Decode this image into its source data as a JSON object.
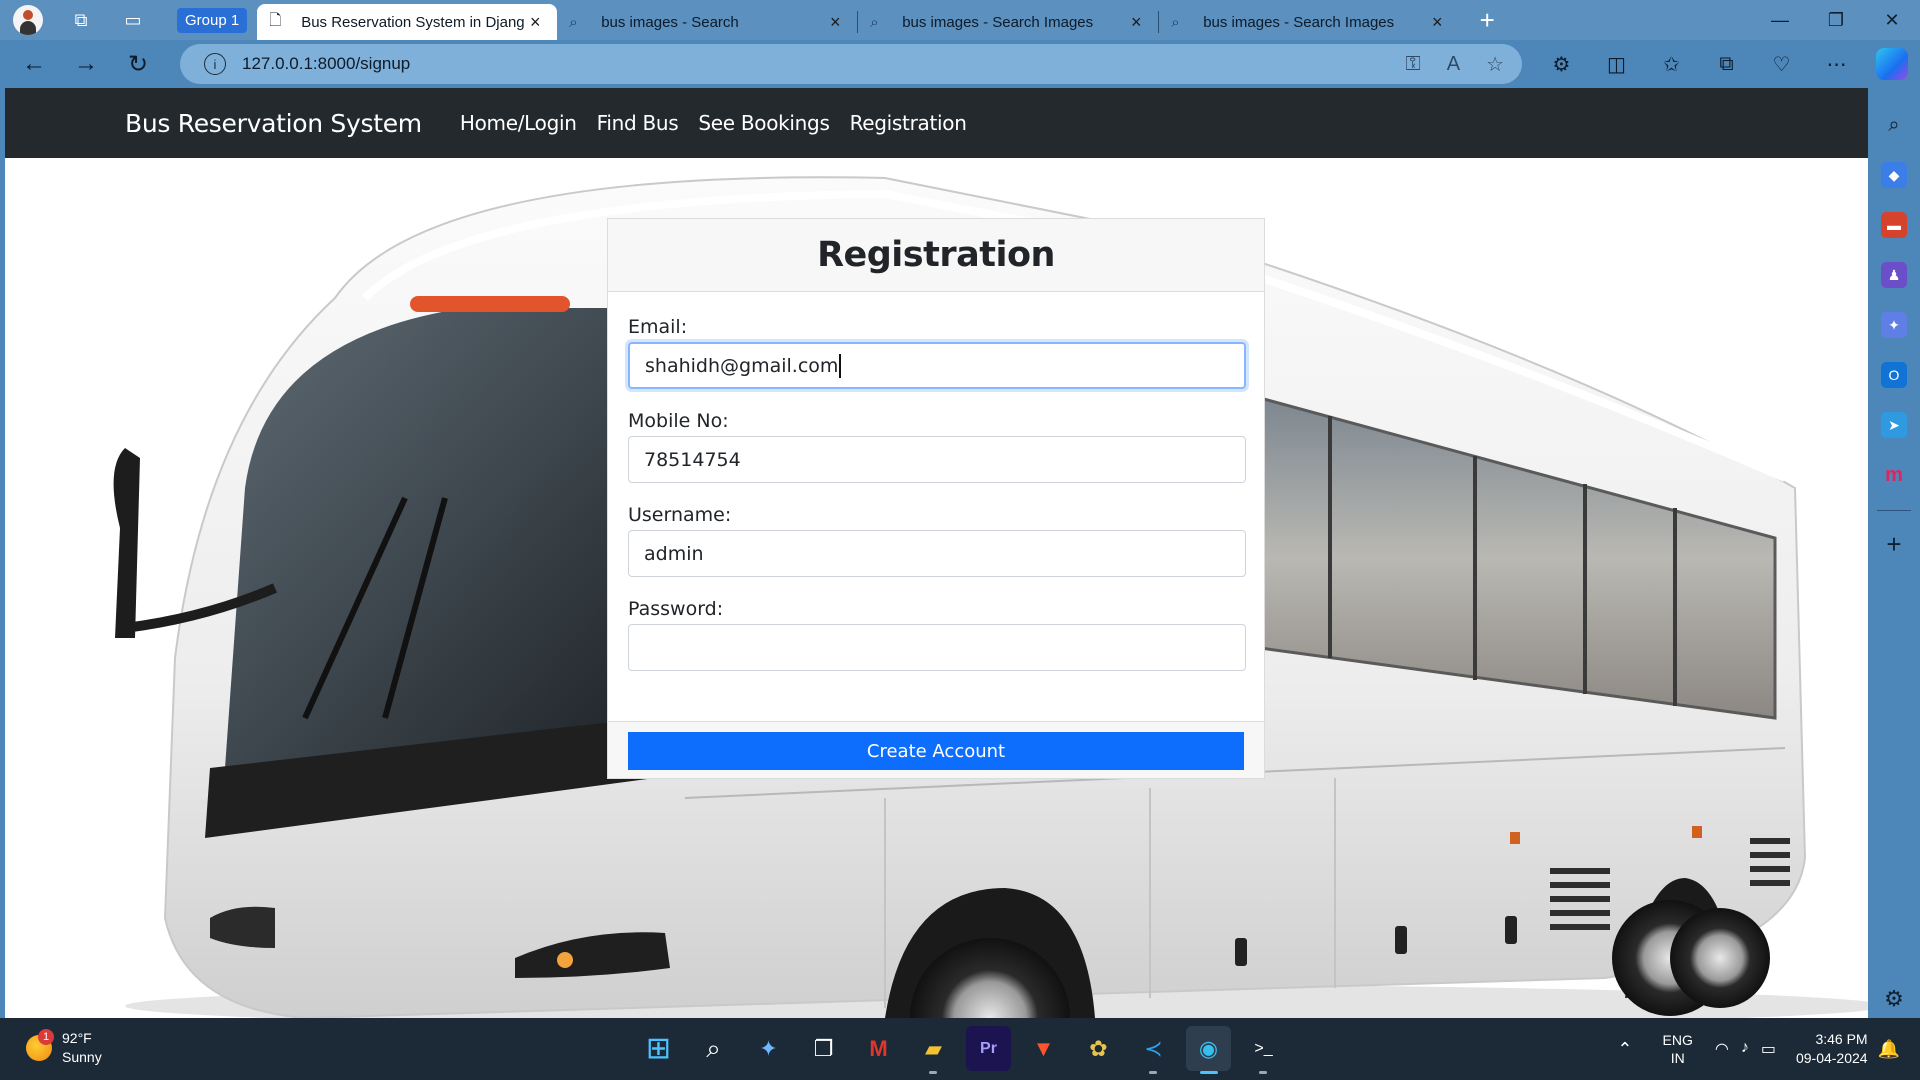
{
  "browser": {
    "group_label": "Group 1",
    "tabs": [
      {
        "title": "Bus Reservation System in Django",
        "active": true,
        "icon": "page-icon"
      },
      {
        "title": "bus images - Search",
        "active": false,
        "icon": "search-icon"
      },
      {
        "title": "bus images - Search Images",
        "active": false,
        "icon": "search-icon"
      },
      {
        "title": "bus images - Search Images",
        "active": false,
        "icon": "search-icon"
      }
    ],
    "url": "127.0.0.1:8000/signup"
  },
  "site": {
    "brand": "Bus Reservation System",
    "nav": [
      "Home/Login",
      "Find Bus",
      "See Bookings",
      "Registration"
    ]
  },
  "form": {
    "title": "Registration",
    "fields": [
      {
        "label": "Email:",
        "value": "shahidh@gmail.com"
      },
      {
        "label": "Mobile No:",
        "value": "78514754"
      },
      {
        "label": "Username:",
        "value": "admin"
      },
      {
        "label": "Password:",
        "value": ""
      }
    ],
    "submit_label": "Create Account"
  },
  "taskbar": {
    "weather_badge": "1",
    "temperature": "92°F",
    "condition": "Sunny",
    "language_top": "ENG",
    "language_bottom": "IN",
    "time": "3:46 PM",
    "date": "09-04-2024"
  },
  "colors": {
    "accent": "#0d6efd",
    "navbar": "#24292e",
    "browser_frame": "#4d86b8"
  }
}
